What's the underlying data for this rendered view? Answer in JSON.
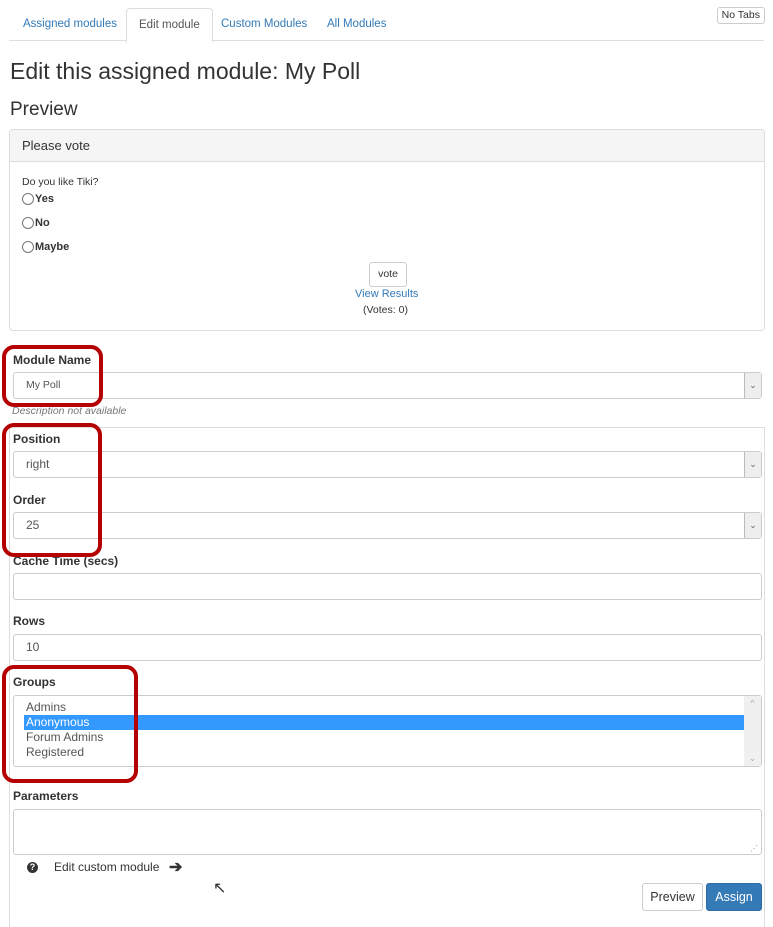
{
  "tabs": [
    {
      "label": "Assigned modules",
      "active": false
    },
    {
      "label": "Edit module",
      "active": true
    },
    {
      "label": "Custom Modules",
      "active": false
    },
    {
      "label": "All Modules",
      "active": false
    }
  ],
  "no_tabs_label": "No Tabs",
  "page_title": "Edit this assigned module: My Poll",
  "preview_heading": "Preview",
  "poll": {
    "title": "Please vote",
    "question": "Do you like Tiki?",
    "options": [
      "Yes",
      "No",
      "Maybe"
    ],
    "vote_label": "vote",
    "view_results_label": "View Results",
    "votes_text": "(Votes: 0)"
  },
  "form": {
    "module_name_label": "Module Name",
    "module_name_value": "My Poll",
    "description": "Description not available",
    "position_label": "Position",
    "position_value": "right",
    "order_label": "Order",
    "order_value": "25",
    "cache_time_label": "Cache Time (secs)",
    "cache_time_value": "",
    "rows_label": "Rows",
    "rows_value": "10",
    "groups_label": "Groups",
    "groups": [
      {
        "label": "Admins",
        "selected": false
      },
      {
        "label": "Anonymous",
        "selected": true
      },
      {
        "label": "Forum Admins",
        "selected": false
      },
      {
        "label": "Registered",
        "selected": false
      }
    ],
    "parameters_label": "Parameters",
    "parameters_value": ""
  },
  "edit_custom_module_label": "Edit custom module",
  "buttons": {
    "preview": "Preview",
    "assign": "Assign"
  },
  "icons": {
    "select_arrow": "⌄",
    "help": "?",
    "arrow_right": "➔",
    "cursor": "↖",
    "scroll_up": "^",
    "scroll_down": "⌄",
    "resize_grip": "⋰"
  },
  "colors": {
    "link": "#337ab7",
    "primary_button": "#337ab7",
    "selection": "#3399ff",
    "highlight_annotation": "#b40000"
  }
}
